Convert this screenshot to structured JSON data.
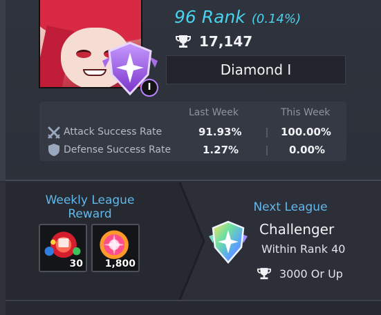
{
  "player": {
    "rank_label": "96 Rank",
    "rank_percent": "(0.14%)",
    "trophy_score": "17,147",
    "league_name": "Diamond I",
    "tier_numeral": "I"
  },
  "stats": {
    "col_last_week": "Last Week",
    "col_this_week": "This Week",
    "rows": [
      {
        "label": "Attack Success Rate",
        "icon": "crossed-swords-icon",
        "last_week": "91.93%",
        "this_week": "100.00%"
      },
      {
        "label": "Defense Success Rate",
        "icon": "shield-icon",
        "last_week": "1.27%",
        "this_week": "0.00%"
      }
    ]
  },
  "weekly_reward": {
    "title": "Weekly League Reward",
    "items": [
      {
        "icon": "red-gem-bundle-icon",
        "count": "30"
      },
      {
        "icon": "pink-orb-icon",
        "count": "1,800"
      }
    ]
  },
  "next_league": {
    "title": "Next League",
    "name": "Challenger",
    "condition": "Within Rank 40",
    "trophy_requirement": "3000 Or Up"
  },
  "colors": {
    "accent_cyan": "#49d2ee",
    "section_title_blue": "#61b8ee",
    "diamond_purple": "#9a4fe0"
  }
}
